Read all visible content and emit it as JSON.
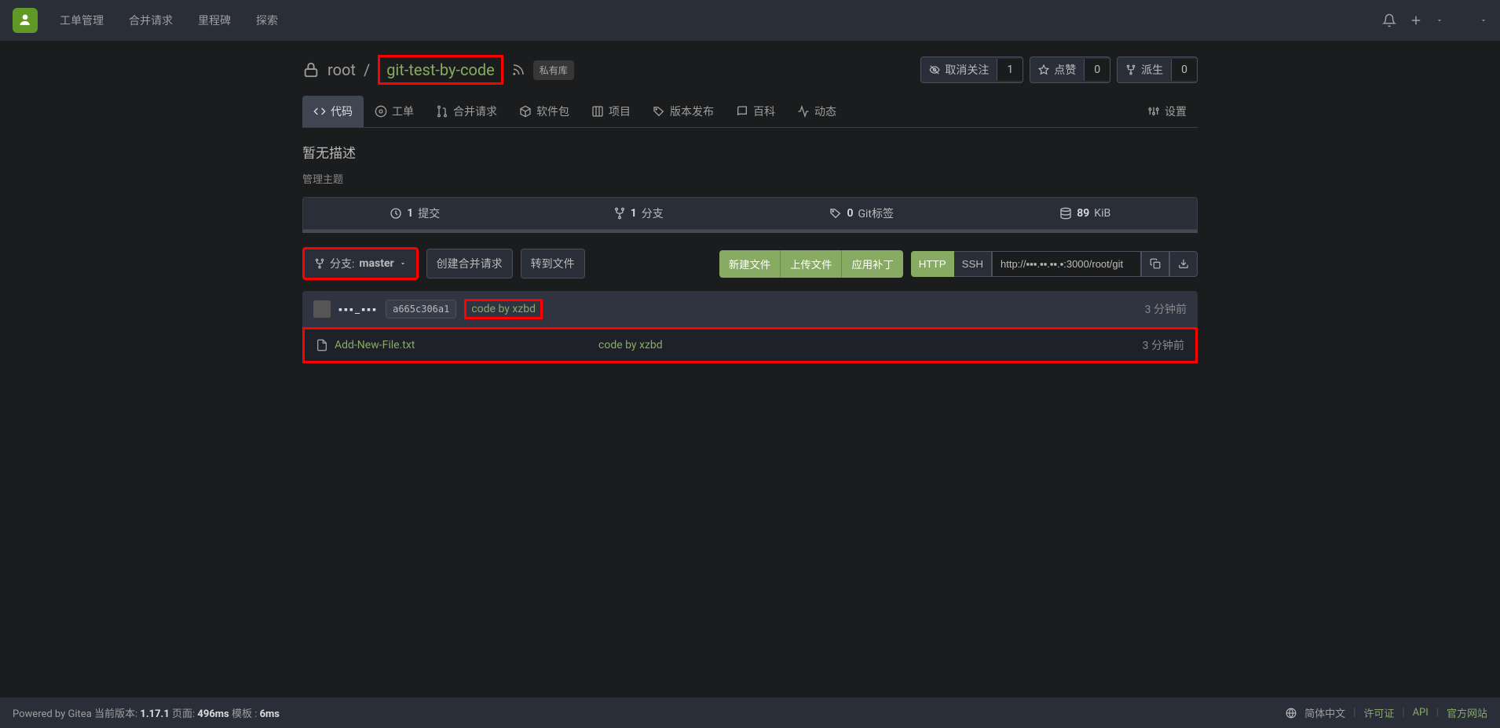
{
  "nav": {
    "items": [
      "工单管理",
      "合并请求",
      "里程碑",
      "探索"
    ]
  },
  "repo": {
    "owner": "root",
    "name": "git-test-by-code",
    "private_label": "私有库",
    "description": "暂无描述",
    "manage_link": "管理主题"
  },
  "actions": {
    "unwatch": {
      "label": "取消关注",
      "count": "1"
    },
    "star": {
      "label": "点赞",
      "count": "0"
    },
    "fork": {
      "label": "派生",
      "count": "0"
    }
  },
  "tabs": {
    "code": "代码",
    "issues": "工单",
    "pulls": "合并请求",
    "packages": "软件包",
    "projects": "项目",
    "releases": "版本发布",
    "wiki": "百科",
    "activity": "动态",
    "settings": "设置"
  },
  "stats": {
    "commits": {
      "count": "1",
      "label": "提交"
    },
    "branches": {
      "count": "1",
      "label": "分支"
    },
    "tags": {
      "count": "0",
      "label": "Git标签"
    },
    "size": {
      "count": "89",
      "label": "KiB"
    }
  },
  "toolbar": {
    "branch_prefix": "分支:",
    "branch_name": "master",
    "new_pr": "创建合并请求",
    "goto_file": "转到文件",
    "new_file": "新建文件",
    "upload_file": "上传文件",
    "apply_patch": "应用补丁",
    "http": "HTTP",
    "ssh": "SSH",
    "clone_url": "http://▪▪▪.▪▪.▪▪.▪:3000/root/git"
  },
  "commit": {
    "author": "▪▪▪_▪▪▪",
    "sha": "a665c306a1",
    "message": "code by xzbd",
    "time": "3 分钟前"
  },
  "files": [
    {
      "name": "Add-New-File.txt",
      "message": "code by xzbd",
      "time": "3 分钟前"
    }
  ],
  "footer": {
    "powered": "Powered by Gitea",
    "version_label": "当前版本:",
    "version": "1.17.1",
    "page_label": "页面:",
    "page_time": "496ms",
    "template_label": "模板 :",
    "template_time": "6ms",
    "lang": "简体中文",
    "license": "许可证",
    "api": "API",
    "website": "官方网站"
  }
}
